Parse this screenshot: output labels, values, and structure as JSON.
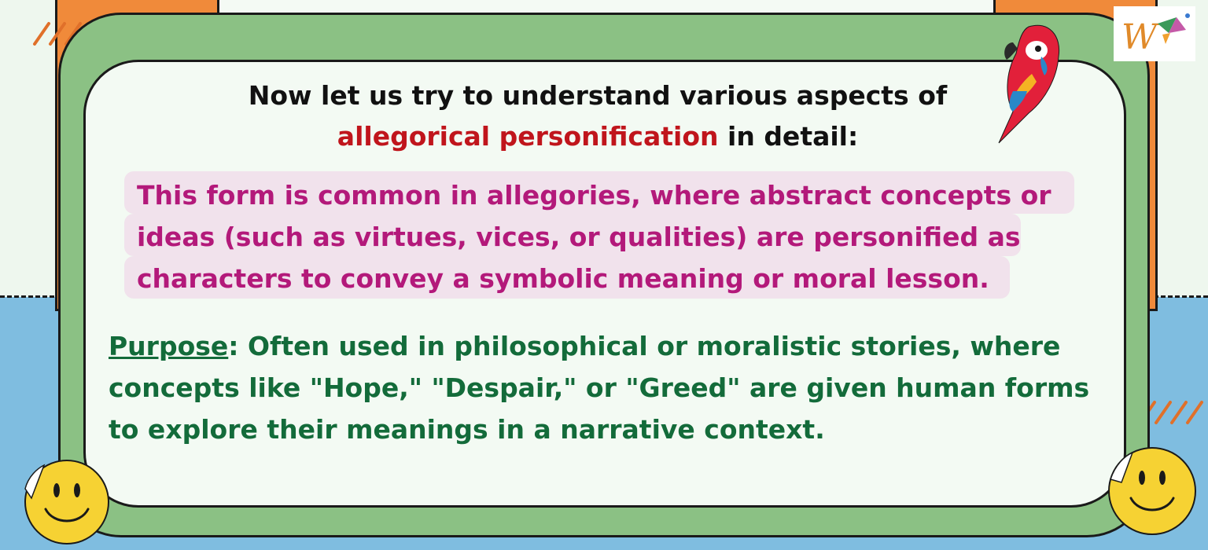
{
  "heading": {
    "line1": "Now let us try to understand various aspects of",
    "highlight": "allegorical personification",
    "suffix": " in detail:"
  },
  "definition": {
    "text": "This form is common in allegories, where abstract concepts or ideas (such as virtues, vices, or qualities) are personified as characters to convey a symbolic meaning or moral lesson."
  },
  "purpose": {
    "label": "Purpose",
    "text": ": Often used in philosophical or moralistic stories, where concepts like \"Hope,\" \"Despair,\" or \"Greed\" are given human forms to explore their meanings in a narrative context."
  },
  "colors": {
    "heading": "#111111",
    "highlight": "#c0151c",
    "definition": "#b3197a",
    "purpose": "#136b3a",
    "frame_green": "#8bc184",
    "orange": "#f08a3a",
    "sky": "#7fbde0"
  },
  "icons": [
    "parrot-icon",
    "smiley-icon",
    "logo-icon",
    "hatch-marks-icon"
  ]
}
